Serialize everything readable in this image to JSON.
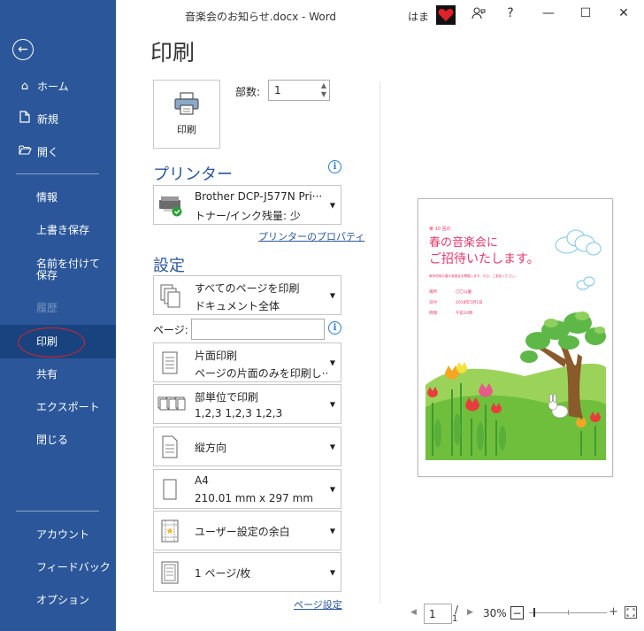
{
  "window": {
    "title": "音楽会のお知らせ.docx  -  Word",
    "user": "はま",
    "help": "?"
  },
  "sidebar": {
    "home": "ホーム",
    "new": "新規",
    "open": "開く",
    "info": "情報",
    "save": "上書き保存",
    "save_as": "名前を付けて保存",
    "history": "履歴",
    "print": "印刷",
    "share": "共有",
    "export": "エクスポート",
    "close": "閉じる",
    "account": "アカウント",
    "feedback": "フィードバック",
    "options": "オプション"
  },
  "main": {
    "title": "印刷",
    "print_button": "印刷",
    "copies_label": "部数:",
    "copies_value": "1",
    "printer_heading": "プリンター",
    "printer_name": "Brother DCP-J577N Pri···",
    "printer_status": "トナー/インク残量: 少",
    "printer_properties": "プリンターのプロパティ",
    "settings_heading": "設定",
    "pages_label": "ページ:",
    "page_setup_link": "ページ設定",
    "settings": [
      {
        "line1": "すべてのページを印刷",
        "line2": "ドキュメント全体"
      },
      {
        "line1": "片面印刷",
        "line2": "ページの片面のみを印刷し···"
      },
      {
        "line1": "部単位で印刷",
        "line2": "1,2,3    1,2,3    1,2,3"
      },
      {
        "line1": "縦方向",
        "line2": ""
      },
      {
        "line1": "A4",
        "line2": "210.01 mm x 297 mm"
      },
      {
        "line1": "ユーザー設定の余白",
        "line2": ""
      },
      {
        "line1": "1 ページ/枚",
        "line2": ""
      }
    ]
  },
  "preview": {
    "small_heading": "第 10 回の",
    "headline1": "春の音楽会に",
    "headline2": "ご招待いたします。",
    "intro": "毎年恒例の春の音楽会を開催します。ぜひ、ご参加ください。",
    "rows": [
      {
        "label": "場所",
        "value": "〇〇公園"
      },
      {
        "label": "日付",
        "value": "2018年5月1日"
      },
      {
        "label": "時間",
        "value": "午前10時"
      }
    ],
    "page_current": "1",
    "page_total": "1",
    "zoom": "30%"
  },
  "colors": {
    "sidebar": "#2b579a",
    "sidebar_selected": "#19437f",
    "accent": "#2b579a",
    "highlight": "#e0202a",
    "preview_headline": "#e6386a"
  }
}
